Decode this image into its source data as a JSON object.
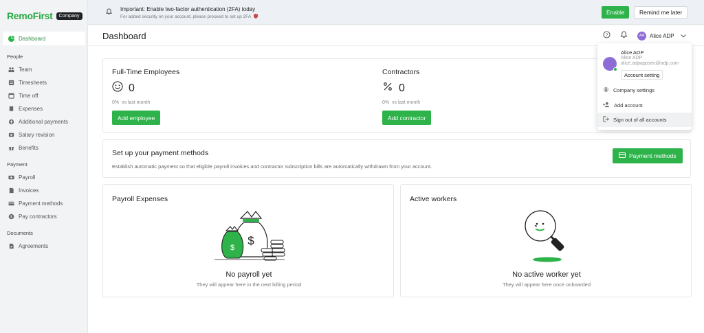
{
  "app": {
    "logo": "RemoFirst",
    "badge": "Company"
  },
  "sidebar": {
    "dashboard": "Dashboard",
    "sections": {
      "people": "People",
      "payment": "Payment",
      "documents": "Documents"
    },
    "people_items": [
      {
        "label": "Team",
        "icon": "team-icon"
      },
      {
        "label": "Timesheets",
        "icon": "timesheets-icon"
      },
      {
        "label": "Time off",
        "icon": "calendar-icon"
      },
      {
        "label": "Expenses",
        "icon": "expenses-icon"
      },
      {
        "label": "Additional payments",
        "icon": "additional-payments-icon"
      },
      {
        "label": "Salary revision",
        "icon": "salary-revision-icon"
      },
      {
        "label": "Benefits",
        "icon": "gift-icon"
      }
    ],
    "payment_items": [
      {
        "label": "Payroll",
        "icon": "payroll-icon"
      },
      {
        "label": "Invoices",
        "icon": "invoices-icon"
      },
      {
        "label": "Payment methods",
        "icon": "card-icon"
      },
      {
        "label": "Pay contractors",
        "icon": "dollar-icon"
      }
    ],
    "document_items": [
      {
        "label": "Agreements",
        "icon": "document-icon"
      }
    ]
  },
  "banner": {
    "title": "Important: Enable two-factor authentication (2FA) today",
    "subtitle": "For added security on your account, please proceed to set up 2FA",
    "enable": "Enable",
    "remind": "Remind me later"
  },
  "header": {
    "title": "Dashboard",
    "user_initials": "AA",
    "user_name": "Alice ADP"
  },
  "cards": {
    "fulltime": {
      "title": "Full-Time Employees",
      "count": "0",
      "change": "0%",
      "change_label": "vs last month",
      "button": "Add employee"
    },
    "contractors": {
      "title": "Contractors",
      "count": "0",
      "change": "0%",
      "change_label": "vs last month",
      "button": "Add contractor"
    },
    "payment_methods": {
      "title": "Set up your payment methods",
      "desc": "Establish automatic payment so that eligible payroll invoices and contractor subscription bills are automatically withdrawn from your account.",
      "button": "Payment methods"
    },
    "payroll": {
      "title": "Payroll Expenses",
      "empty_title": "No payroll yet",
      "empty_sub": "They will appear here in the next billing period"
    },
    "workers": {
      "title": "Active workers",
      "empty_title": "No active worker yet",
      "empty_sub": "They will appear here once onboarded"
    }
  },
  "dropdown": {
    "name": "Alice ADP",
    "name2": "Alice ADP",
    "email": "alice.adpappsec@adp.com",
    "account_setting": "Account setting",
    "company_settings": "Company settings",
    "add_account": "Add account",
    "sign_out": "Sign out of all accounts"
  },
  "colors": {
    "brand": "#2db34a",
    "avatar": "#8e6cd6"
  }
}
